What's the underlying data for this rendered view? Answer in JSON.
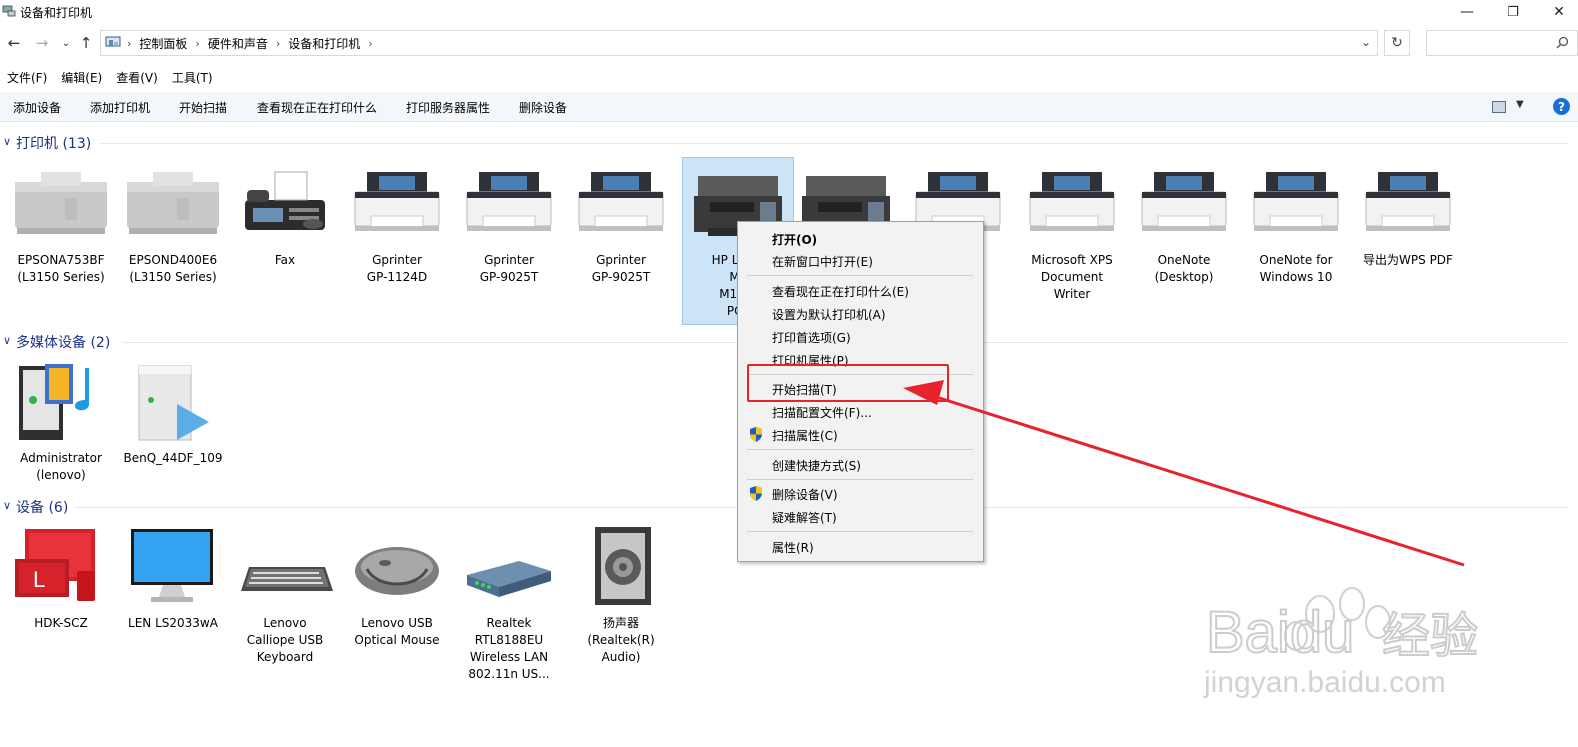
{
  "window": {
    "title": "设备和打印机"
  },
  "address": {
    "crumbs": [
      "控制面板",
      "硬件和声音",
      "设备和打印机"
    ],
    "search_placeholder": ""
  },
  "menus": [
    "文件(F)",
    "编辑(E)",
    "查看(V)",
    "工具(T)"
  ],
  "commands": [
    "添加设备",
    "添加打印机",
    "开始扫描",
    "查看现在正在打印什么",
    "打印服务器属性",
    "删除设备"
  ],
  "groups": {
    "printers": {
      "title": "打印机 (13)"
    },
    "multimedia": {
      "title": "多媒体设备 (2)"
    },
    "devices": {
      "title": "设备 (6)"
    }
  },
  "printers": [
    {
      "label": "EPSONA753BF\n(L3150 Series)",
      "icon": "inkjet-printer-icon"
    },
    {
      "label": "EPSOND400E6\n(L3150 Series)",
      "icon": "inkjet-printer-icon"
    },
    {
      "label": "Fax",
      "icon": "fax-icon"
    },
    {
      "label": "Gprinter\nGP-1124D",
      "icon": "printer-icon"
    },
    {
      "label": "Gprinter\nGP-9025T",
      "icon": "printer-icon"
    },
    {
      "label": "Gprinter\nGP-9025T",
      "icon": "printer-icon"
    },
    {
      "label": "HP Laser\nMF\nM125-\nPCL",
      "icon": "laser-mfp-icon"
    },
    {
      "label": "",
      "icon": "laser-mfp-icon"
    },
    {
      "label": "rint",
      "icon": "printer-icon"
    },
    {
      "label": "Microsoft XPS\nDocument\nWriter",
      "icon": "printer-icon"
    },
    {
      "label": "OneNote\n(Desktop)",
      "icon": "printer-icon"
    },
    {
      "label": "OneNote for\nWindows 10",
      "icon": "printer-icon"
    },
    {
      "label": "导出为WPS PDF",
      "icon": "printer-icon"
    }
  ],
  "multimedia": [
    {
      "label": "Administrator\n(lenovo)",
      "icon": "media-server-icon"
    },
    {
      "label": "BenQ_44DF_109",
      "icon": "media-renderer-icon"
    }
  ],
  "devices": [
    {
      "label": "HDK-SCZ",
      "icon": "computer-icon"
    },
    {
      "label": "LEN LS2033wA",
      "icon": "monitor-icon"
    },
    {
      "label": "Lenovo\nCalliope USB\nKeyboard",
      "icon": "keyboard-icon"
    },
    {
      "label": "Lenovo USB\nOptical Mouse",
      "icon": "mouse-icon"
    },
    {
      "label": "Realtek\nRTL8188EU\nWireless LAN\n802.11n US...",
      "icon": "network-adapter-icon"
    },
    {
      "label": "扬声器\n(Realtek(R)\nAudio)",
      "icon": "speaker-icon"
    }
  ],
  "context_menu": {
    "open": "打开(O)",
    "open_new_window": "在新窗口中打开(E)",
    "see_printing": "查看现在正在打印什么(E)",
    "set_default": "设置为默认打印机(A)",
    "print_prefs": "打印首选项(G)",
    "printer_props": "打印机属性(P)",
    "start_scan": "开始扫描(T)",
    "scan_profiles": "扫描配置文件(F)...",
    "scan_props": "扫描属性(C)",
    "create_shortcut": "创建快捷方式(S)",
    "remove_device": "删除设备(V)",
    "troubleshoot": "疑难解答(T)",
    "properties": "属性(R)"
  },
  "watermark": {
    "brand": "Baidu",
    "cn": "经验",
    "url": "jingyan.baidu.com"
  },
  "colors": {
    "accent": "#1e3287",
    "highlight": "#e8232e",
    "selection": "#cce4f7"
  }
}
